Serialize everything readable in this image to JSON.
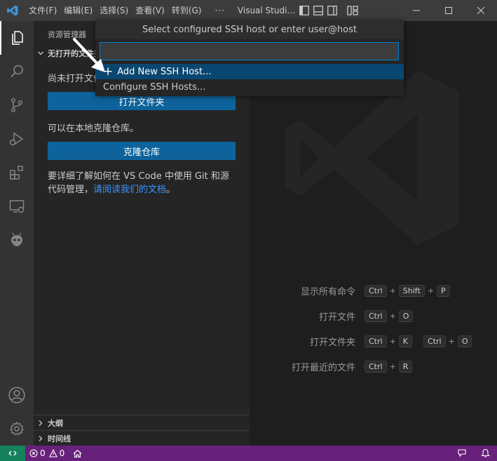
{
  "titlebar": {
    "menus": [
      "文件(F)",
      "编辑(E)",
      "选择(S)",
      "查看(V)",
      "转到(G)"
    ],
    "more": "···",
    "window_title": "Visual Studi..."
  },
  "sidebar": {
    "header": "资源管理器",
    "section_title": "无打开的文件夹",
    "not_opened": "尚未打开文件夹。",
    "open_folder_button": "打开文件夹",
    "clone_hint": "可以在本地克隆仓库。",
    "clone_button": "克隆仓库",
    "git_para_prefix": "要详细了解如何在 VS Code 中使用 Git 和源代码管理，",
    "git_para_link": "请阅读我们的文档",
    "git_para_suffix": "。",
    "outline": "大纲",
    "timeline": "时间线"
  },
  "quickpick": {
    "title": "Select configured SSH host or enter user@host",
    "input_value": "",
    "items": [
      {
        "label": "Add New SSH Host...",
        "icon": "plus-icon",
        "selected": true
      },
      {
        "label": "Configure SSH Hosts...",
        "selected": false
      }
    ]
  },
  "editor": {
    "shortcuts": [
      {
        "label": "显示所有命令",
        "keys": [
          [
            "Ctrl",
            "Shift",
            "P"
          ]
        ]
      },
      {
        "label": "打开文件",
        "keys": [
          [
            "Ctrl",
            "O"
          ]
        ]
      },
      {
        "label": "打开文件夹",
        "keys": [
          [
            "Ctrl",
            "K"
          ],
          [
            "Ctrl",
            "O"
          ]
        ]
      },
      {
        "label": "打开最近的文件",
        "keys": [
          [
            "Ctrl",
            "R"
          ]
        ]
      }
    ]
  },
  "statusbar": {
    "errors": "0",
    "warnings": "0"
  },
  "colors": {
    "statusbar_bg": "#68217a",
    "remote_bg": "#16825d",
    "button_bg": "#0e639c",
    "selection_bg": "#094771",
    "link": "#3794ff"
  }
}
